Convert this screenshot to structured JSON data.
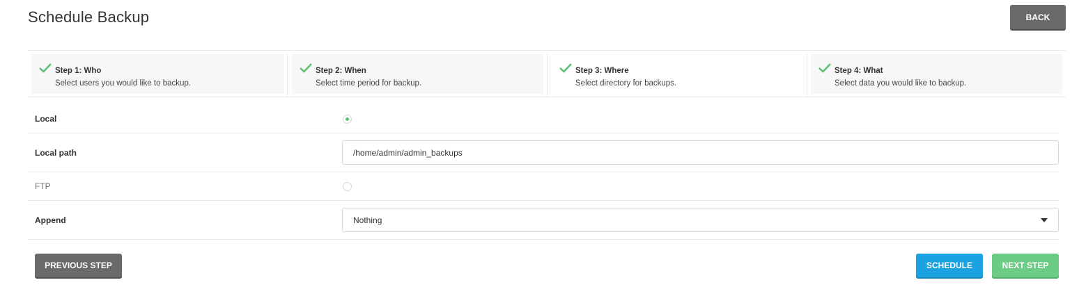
{
  "header": {
    "title": "Schedule Backup",
    "back_label": "BACK"
  },
  "steps": [
    {
      "title": "Step 1: Who",
      "description": "Select users you would like to backup.",
      "completed": true,
      "active": false
    },
    {
      "title": "Step 2: When",
      "description": "Select time period for backup.",
      "completed": true,
      "active": false
    },
    {
      "title": "Step 3: Where",
      "description": "Select directory for backups.",
      "completed": true,
      "active": true
    },
    {
      "title": "Step 4: What",
      "description": "Select data you would like to backup.",
      "completed": true,
      "active": false
    }
  ],
  "form": {
    "local": {
      "label": "Local",
      "selected": true
    },
    "local_path": {
      "label": "Local path",
      "value": "/home/admin/admin_backups"
    },
    "ftp": {
      "label": "FTP",
      "selected": false
    },
    "append": {
      "label": "Append",
      "value": "Nothing"
    }
  },
  "footer": {
    "previous_label": "PREVIOUS STEP",
    "schedule_label": "SCHEDULE",
    "next_label": "NEXT STEP"
  },
  "colors": {
    "check_green": "#5cbf72",
    "schedule_blue": "#1aa3e0",
    "next_green": "#6ccb85",
    "gray_button": "#6a6a6a"
  }
}
